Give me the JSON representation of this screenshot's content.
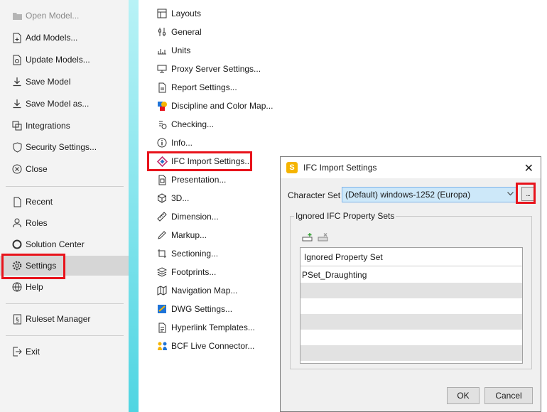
{
  "left_menu": {
    "items": [
      {
        "label": "Open Model...",
        "icon": "folder-icon",
        "disabled": true
      },
      {
        "label": "Add Models...",
        "icon": "file-plus-icon"
      },
      {
        "label": "Update Models...",
        "icon": "file-refresh-icon"
      },
      {
        "label": "Save Model",
        "icon": "download-icon"
      },
      {
        "label": "Save Model as...",
        "icon": "download-as-icon"
      },
      {
        "label": "Integrations",
        "icon": "integrations-icon"
      },
      {
        "label": "Security Settings...",
        "icon": "shield-icon"
      },
      {
        "label": "Close",
        "icon": "close-circle-icon"
      },
      {
        "label": "Recent",
        "icon": "recent-icon"
      },
      {
        "label": "Roles",
        "icon": "person-icon"
      },
      {
        "label": "Solution Center",
        "icon": "solution-center-icon"
      },
      {
        "label": "Settings",
        "icon": "gear-icon",
        "selected": true
      },
      {
        "label": "Help",
        "icon": "help-globe-icon"
      },
      {
        "label": "Ruleset Manager",
        "icon": "ruleset-icon"
      },
      {
        "label": "Exit",
        "icon": "exit-icon"
      }
    ]
  },
  "settings_list": {
    "items": [
      {
        "label": "Layouts",
        "icon": "layout-icon"
      },
      {
        "label": "General",
        "icon": "general-icon"
      },
      {
        "label": "Units",
        "icon": "units-icon"
      },
      {
        "label": "Proxy Server Settings...",
        "icon": "proxy-icon"
      },
      {
        "label": "Report Settings...",
        "icon": "report-icon"
      },
      {
        "label": "Discipline and Color Map...",
        "icon": "color-map-icon"
      },
      {
        "label": "Checking...",
        "icon": "checking-icon"
      },
      {
        "label": "Info...",
        "icon": "info-icon"
      },
      {
        "label": "IFC Import Settings...",
        "icon": "ifc-icon"
      },
      {
        "label": "Presentation...",
        "icon": "presentation-icon"
      },
      {
        "label": "3D...",
        "icon": "cube-icon"
      },
      {
        "label": "Dimension...",
        "icon": "dimension-icon"
      },
      {
        "label": "Markup...",
        "icon": "pencil-icon"
      },
      {
        "label": "Sectioning...",
        "icon": "sectioning-icon"
      },
      {
        "label": "Footprints...",
        "icon": "layers-icon"
      },
      {
        "label": "Navigation Map...",
        "icon": "map-icon"
      },
      {
        "label": "DWG Settings...",
        "icon": "dwg-icon"
      },
      {
        "label": "Hyperlink Templates...",
        "icon": "hyperlink-icon"
      },
      {
        "label": "BCF Live Connector...",
        "icon": "bcf-icon"
      }
    ]
  },
  "dialog": {
    "title": "IFC Import Settings",
    "badge": "S",
    "close_glyph": "✕",
    "character_set_label": "Character Set",
    "character_set_value": "(Default) windows-1252 (Europa)",
    "browse_label": "...",
    "group_label": "Ignored IFC Property Sets",
    "table": {
      "header": "Ignored Property Set",
      "rows": [
        "PSet_Draughting",
        "",
        "",
        "",
        "",
        ""
      ]
    },
    "ok_label": "OK",
    "cancel_label": "Cancel"
  },
  "colors": {
    "highlight": "#e8131b",
    "accent_strip": "#4fd5e2",
    "selected_row": "#cde8f9"
  }
}
